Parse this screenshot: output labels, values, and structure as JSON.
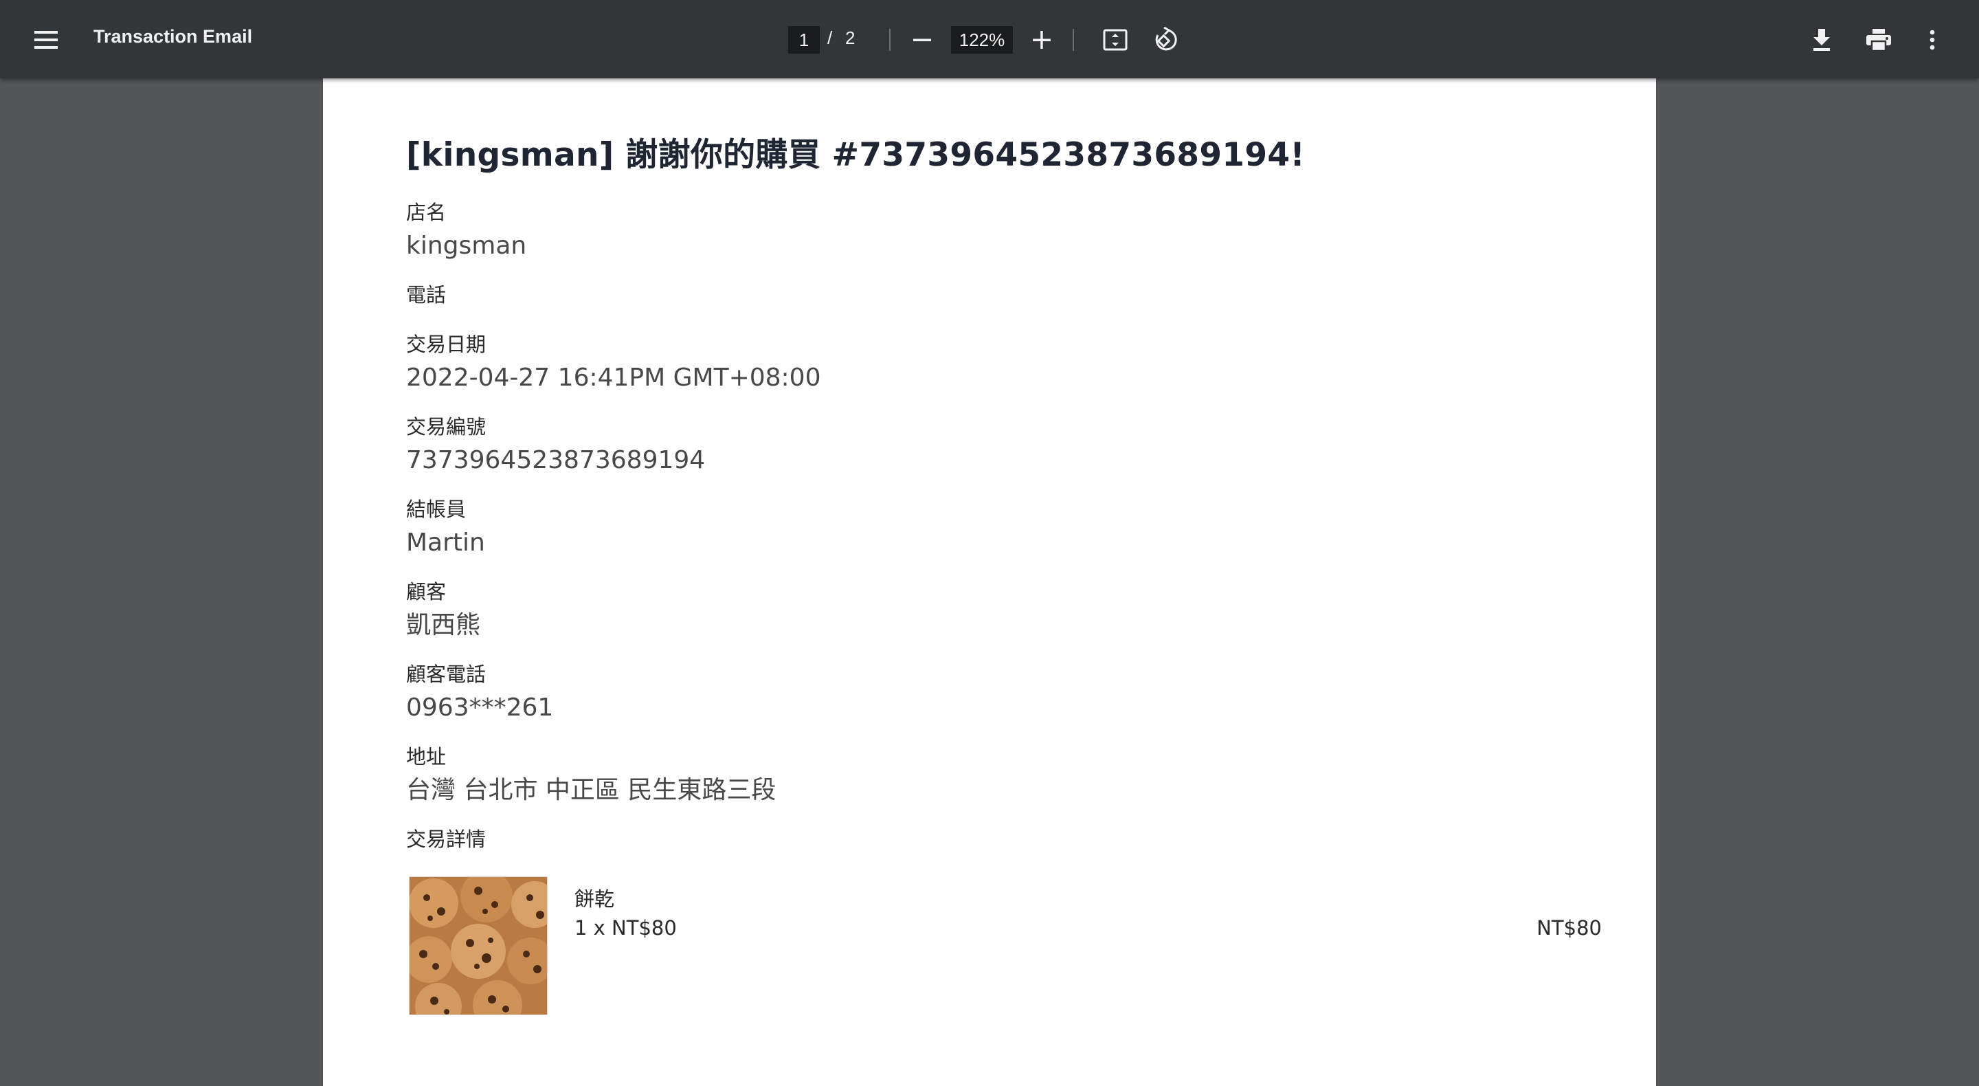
{
  "toolbar": {
    "title": "Transaction Email",
    "page_current": "1",
    "page_separator": "/",
    "page_total": "2",
    "zoom": "122%",
    "icons": [
      "menu-icon",
      "minus-icon",
      "plus-icon",
      "fit-page-icon",
      "rotate-icon",
      "download-icon",
      "print-icon",
      "more-vert-icon"
    ]
  },
  "document": {
    "heading": "[kingsman] 謝謝你的購買 #7373964523873689194!",
    "fields": {
      "store_name": {
        "label": "店名",
        "value": "kingsman"
      },
      "phone": {
        "label": "電話"
      },
      "date": {
        "label": "交易日期",
        "value": "2022-04-27 16:41PM GMT+08:00"
      },
      "transaction_id": {
        "label": "交易編號",
        "value": "7373964523873689194"
      },
      "cashier": {
        "label": "結帳員",
        "value": "Martin"
      },
      "customer": {
        "label": "顧客",
        "value": "凱西熊"
      },
      "customer_phone": {
        "label": "顧客電話",
        "value": "0963***261"
      },
      "address": {
        "label": "地址",
        "value": "台灣 台北市 中正區 民生東路三段"
      },
      "details": {
        "label": "交易詳情"
      }
    },
    "items": [
      {
        "name": "餅乾",
        "quantity_line": "1 x NT$80",
        "total": "NT$80"
      }
    ]
  },
  "colors": {
    "toolbar_bg": "#323639",
    "viewer_bg": "#525659",
    "page_bg": "#ffffff",
    "heading": "#1f2533"
  }
}
